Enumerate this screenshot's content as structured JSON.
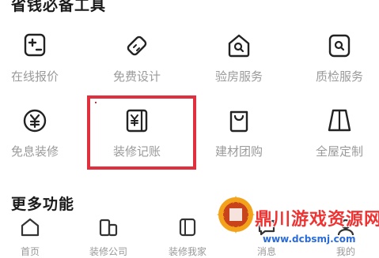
{
  "sections": {
    "top_title": "省钱必备工具",
    "more_title": "更多功能"
  },
  "tools": [
    {
      "label": "在线报价",
      "icon": "price-calculator-icon"
    },
    {
      "label": "免费设计",
      "icon": "design-ruler-icon"
    },
    {
      "label": "验房服务",
      "icon": "house-inspect-icon"
    },
    {
      "label": "质检服务",
      "icon": "quality-check-icon"
    },
    {
      "label": "免息装修",
      "icon": "yuan-coin-icon"
    },
    {
      "label": "装修记账",
      "icon": "ledger-icon"
    },
    {
      "label": "建材团购",
      "icon": "shopping-bag-icon"
    },
    {
      "label": "全屋定制",
      "icon": "wardrobe-icon"
    }
  ],
  "tabbar": [
    {
      "label": "首页",
      "icon": "home-icon"
    },
    {
      "label": "装修公司",
      "icon": "company-icon"
    },
    {
      "label": "装修我家",
      "icon": "book-icon"
    },
    {
      "label": "消息",
      "icon": "message-icon"
    },
    {
      "label": "我的",
      "icon": "user-icon"
    }
  ],
  "watermark": {
    "text": "鼎川游戏资源网",
    "url": "www.dcbsmj.com"
  },
  "colors": {
    "highlight": "#e0303d",
    "icon_stroke": "#222222",
    "label": "#9a9a9a"
  }
}
